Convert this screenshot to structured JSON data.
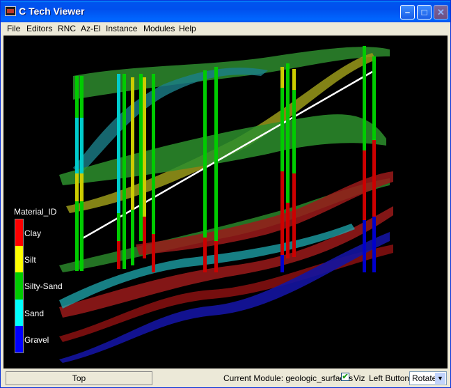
{
  "window": {
    "title": "C Tech Viewer"
  },
  "menu": [
    "File",
    "Editors",
    "RNC",
    "Az-El",
    "Instance",
    "Modules",
    "Help"
  ],
  "legend": {
    "title": "Material_ID",
    "items": [
      {
        "label": "Clay",
        "color": "#ff0000"
      },
      {
        "label": "Silt",
        "color": "#ffff00"
      },
      {
        "label": "Silty-Sand",
        "color": "#00cc00"
      },
      {
        "label": "Sand",
        "color": "#00ffff"
      },
      {
        "label": "Gravel",
        "color": "#0000ff"
      }
    ]
  },
  "statusbar": {
    "top_button": "Top",
    "current_module": "Current Module: geologic_surfaces",
    "viz_label": "Viz",
    "viz_checked": "✔",
    "left_button_label": "Left Button",
    "mode_value": "Rotate"
  }
}
